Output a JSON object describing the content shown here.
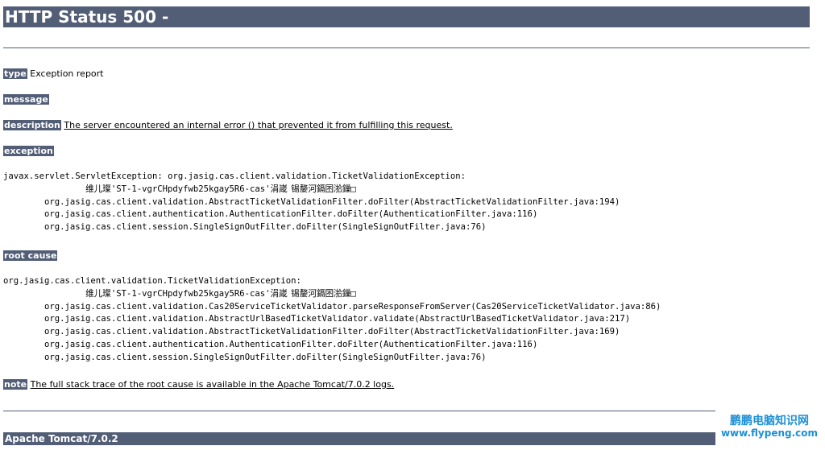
{
  "page_title": "HTTP Status 500 -",
  "sections": {
    "type": {
      "label": "type",
      "value": "Exception report"
    },
    "message": {
      "label": "message",
      "value": ""
    },
    "description": {
      "label": "description",
      "value": "The server encountered an internal error () that prevented it from fulfilling this request."
    },
    "exception": {
      "label": "exception",
      "trace": "javax.servlet.ServletException: org.jasig.cas.client.validation.TicketValidationException: \n\t\t维儿璨'ST-1-vgrCHpdyfwb25kgay5R6-cas'涓嵅\t锡嫠河鎘囨湁鏁□\n\torg.jasig.cas.client.validation.AbstractTicketValidationFilter.doFilter(AbstractTicketValidationFilter.java:194)\n\torg.jasig.cas.client.authentication.AuthenticationFilter.doFilter(AuthenticationFilter.java:116)\n\torg.jasig.cas.client.session.SingleSignOutFilter.doFilter(SingleSignOutFilter.java:76)"
    },
    "root_cause": {
      "label": "root cause",
      "trace": "org.jasig.cas.client.validation.TicketValidationException: \n\t\t维儿璨'ST-1-vgrCHpdyfwb25kgay5R6-cas'涓嵅\t锡嫠河鎘囨湁鏁□\n\torg.jasig.cas.client.validation.Cas20ServiceTicketValidator.parseResponseFromServer(Cas20ServiceTicketValidator.java:86)\n\torg.jasig.cas.client.validation.AbstractUrlBasedTicketValidator.validate(AbstractUrlBasedTicketValidator.java:217)\n\torg.jasig.cas.client.validation.AbstractTicketValidationFilter.doFilter(AbstractTicketValidationFilter.java:169)\n\torg.jasig.cas.client.authentication.AuthenticationFilter.doFilter(AuthenticationFilter.java:116)\n\torg.jasig.cas.client.session.SingleSignOutFilter.doFilter(SingleSignOutFilter.java:76)"
    },
    "note": {
      "label": "note",
      "value": "The full stack trace of the root cause is available in the Apache Tomcat/7.0.2 logs."
    }
  },
  "footer": {
    "server": "Apache Tomcat/7.0.2"
  },
  "watermark": {
    "site_name": "鹏鹏电脑知识网",
    "url": "www.flypeng.com"
  },
  "colors": {
    "header_bg": "#525D76",
    "header_text": "#FFFFFF",
    "watermark": "#1D8FD6"
  }
}
